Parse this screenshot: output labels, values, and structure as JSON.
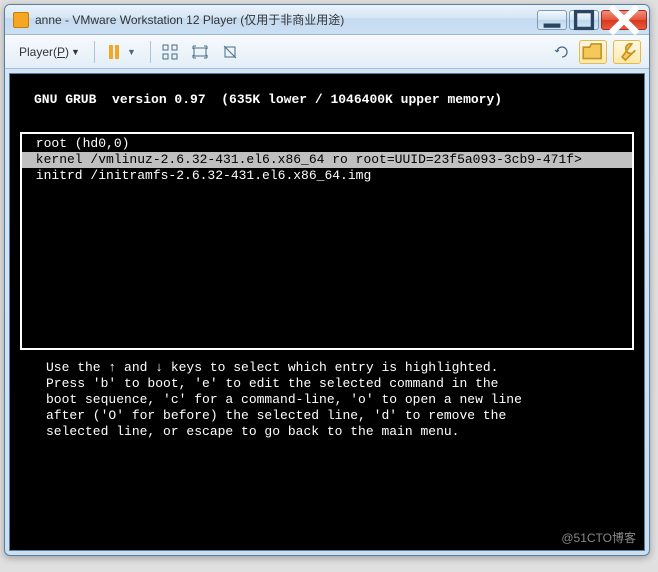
{
  "window": {
    "title": "anne - VMware Workstation 12 Player (仅用于非商业用途)"
  },
  "toolbar": {
    "player_label": "Player(P)"
  },
  "grub": {
    "header": "GNU GRUB  version 0.97  (635K lower / 1046400K upper memory)",
    "entries": [
      {
        "text": " root (hd0,0)",
        "selected": false
      },
      {
        "text": " kernel /vmlinuz-2.6.32-431.el6.x86_64 ro root=UUID=23f5a093-3cb9-471f>",
        "selected": true
      },
      {
        "text": " initrd /initramfs-2.6.32-431.el6.x86_64.img",
        "selected": false
      }
    ],
    "help": "Use the ↑ and ↓ keys to select which entry is highlighted.\nPress 'b' to boot, 'e' to edit the selected command in the\nboot sequence, 'c' for a command-line, 'o' to open a new line\nafter ('O' for before) the selected line, 'd' to remove the\nselected line, or escape to go back to the main menu."
  },
  "watermark": "@51CTO博客"
}
